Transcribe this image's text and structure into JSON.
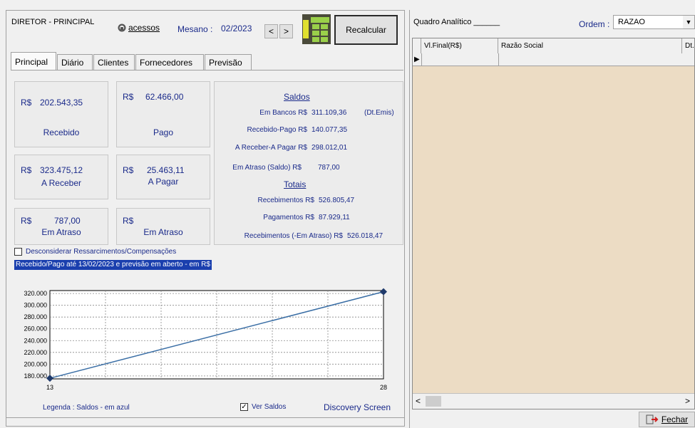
{
  "header": {
    "user_label": "DIRETOR - PRINCIPAL",
    "acessos_label": "acessos",
    "mesano_label": "Mesano :",
    "mesano_value": "02/2023",
    "prev_label": "<",
    "next_label": ">",
    "recalcular_label": "Recalcular"
  },
  "tabs": [
    "Principal",
    "Diário",
    "Clientes",
    "Fornecedores",
    "Previsão"
  ],
  "cards": {
    "recebido": {
      "currency": "R$",
      "value": "202.543,35",
      "label": "Recebido"
    },
    "pago": {
      "currency": "R$",
      "value": "62.466,00",
      "label": "Pago"
    },
    "a_receber": {
      "currency": "R$",
      "value": "323.475,12",
      "label": "A Receber"
    },
    "a_pagar": {
      "currency": "R$",
      "value": "25.463,11",
      "label": "A Pagar"
    },
    "em_atraso_rec": {
      "currency": "R$",
      "value": "787,00",
      "label": "Em Atraso"
    },
    "em_atraso_pag": {
      "currency": "R$",
      "value": "",
      "label": "Em Atraso"
    }
  },
  "saldos": {
    "title": "Saldos",
    "em_bancos_label": "Em Bancos R$",
    "em_bancos_value": "311.109,36",
    "dt_emis": "(Dt.Emis)",
    "recebido_pago_label": "Recebido-Pago R$",
    "recebido_pago_value": "140.077,35",
    "areceber_apagar_label": "A Receber-A Pagar R$",
    "areceber_apagar_value": "298.012,01",
    "em_atraso_saldo_label": "Em Atraso (Saldo) R$",
    "em_atraso_saldo_value": "787,00"
  },
  "totais": {
    "title": "Totais",
    "recebimentos_label": "Recebimentos R$",
    "recebimentos_value": "526.805,47",
    "pagamentos_label": "Pagamentos R$",
    "pagamentos_value": "87.929,11",
    "rec_menos_atraso_label": "Recebimentos (-Em Atraso) R$",
    "rec_menos_atraso_value": "526.018,47"
  },
  "options": {
    "desconsiderar_label": "Desconsiderar Ressarcimentos/Compensações",
    "desconsiderar_checked": false,
    "info_label": "Recebido/Pago até 13/02/2023 e previsão em aberto - em R$"
  },
  "chart_data": {
    "type": "line",
    "x": [
      13,
      28
    ],
    "series": [
      {
        "values": [
          176000,
          323000
        ]
      }
    ],
    "ylim": [
      175000,
      325000
    ],
    "yticks": [
      "320.000",
      "300.000",
      "280.000",
      "260.000",
      "240.000",
      "220.000",
      "200.000",
      "180.000"
    ],
    "ytick_values": [
      320000,
      300000,
      280000,
      260000,
      240000,
      220000,
      200000,
      180000
    ],
    "xticks": [
      "13",
      "28"
    ],
    "grid": true,
    "line_color": "#3a6ea5",
    "marker_color": "#1f3a6b"
  },
  "footer_left": {
    "legenda": "Legenda : Saldos - em azul",
    "ver_saldos_label": "Ver Saldos",
    "ver_saldos_checked": true,
    "discovery": "Discovery Screen"
  },
  "right": {
    "quadro_label": "Quadro Analítico ______",
    "ordem_label": "Ordem :",
    "ordem_value": "RAZAO",
    "columns": [
      "Vl.Final(R$)",
      "Razão Social",
      "Dt."
    ],
    "scroll_left": "<",
    "scroll_right": ">",
    "fechar_label": "Fechar",
    "grid_bg": "#ecdcc4"
  }
}
